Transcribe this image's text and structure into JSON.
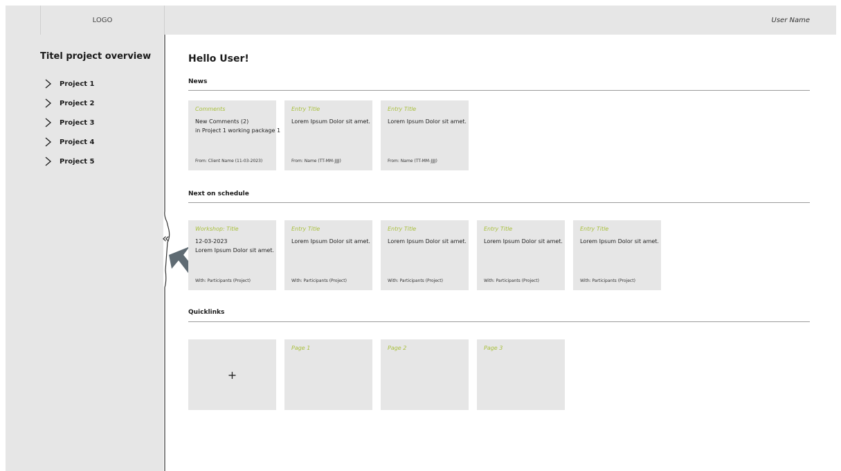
{
  "header": {
    "logo": "LOGO",
    "user_name": "User Name"
  },
  "sidebar": {
    "title": "Titel project overview",
    "items": [
      {
        "label": "Project 1"
      },
      {
        "label": "Project 2"
      },
      {
        "label": "Project 3"
      },
      {
        "label": "Project 4"
      },
      {
        "label": "Project 5"
      }
    ],
    "collapse_glyph": "«"
  },
  "main": {
    "greeting": "Hello User!",
    "news": {
      "title": "News",
      "cards": [
        {
          "title": "Comments",
          "line1": "New Comments (2)",
          "line2": "in Project 1 working package 1",
          "footer": "From: Client Name (11-03-2023)"
        },
        {
          "title": "Entry Title",
          "line1": "Lorem Ipsum Dolor sit amet.",
          "line2": "",
          "footer": "From: Name (TT-MM-JJJJ)"
        },
        {
          "title": "Entry Title",
          "line1": "Lorem Ipsum Dolor sit amet.",
          "line2": "",
          "footer": "From: Name (TT-MM-JJJJ)"
        }
      ]
    },
    "schedule": {
      "title": "Next on schedule",
      "cards": [
        {
          "title": "Workshop: Title",
          "line1": "12-03-2023",
          "line2": "Lorem Ipsum Dolor sit amet.",
          "footer": "With: Participants (Project)"
        },
        {
          "title": "Entry Title",
          "line1": "Lorem Ipsum Dolor sit amet.",
          "line2": "",
          "footer": "With: Participants (Project)"
        },
        {
          "title": "Entry Title",
          "line1": "Lorem Ipsum Dolor sit amet.",
          "line2": "",
          "footer": "With: Participants (Project)"
        },
        {
          "title": "Entry Title",
          "line1": "Lorem Ipsum Dolor sit amet.",
          "line2": "",
          "footer": "With: Participants (Project)"
        },
        {
          "title": "Entry Title",
          "line1": "Lorem Ipsum Dolor sit amet.",
          "line2": "",
          "footer": "With: Participants (Project)"
        }
      ]
    },
    "quicklinks": {
      "title": "Quicklinks",
      "add_glyph": "+",
      "pages": [
        {
          "title": "Page 1"
        },
        {
          "title": "Page 2"
        },
        {
          "title": "Page 3"
        }
      ]
    }
  },
  "colors": {
    "panel": "#e6e6e6",
    "accent": "#a8bf3b",
    "cursor": "#5f6b73"
  }
}
